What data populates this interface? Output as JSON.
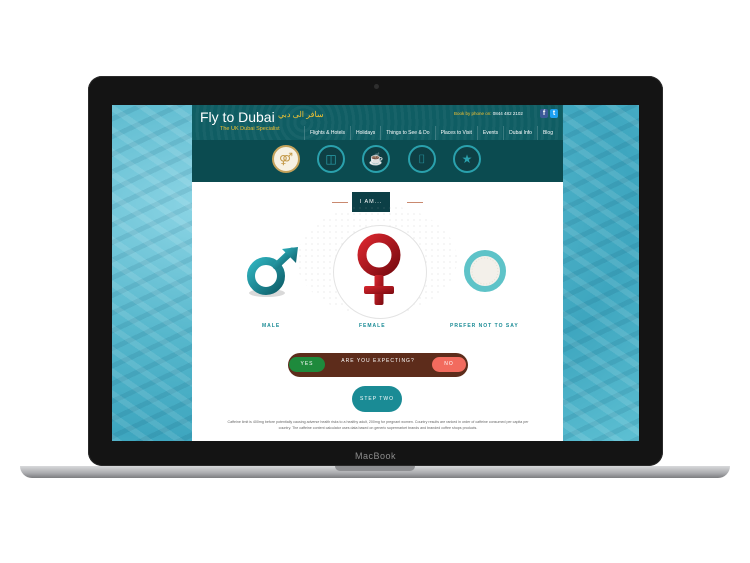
{
  "device": {
    "label": "MacBook"
  },
  "site": {
    "logo_en": "Fly to Dubai",
    "logo_ar": "سافر الى دبي",
    "tagline": "The UK Dubai Specialist",
    "phone_label": "Book by phone on:",
    "phone_number": "0844 482 2102",
    "social": [
      {
        "icon": "facebook-icon",
        "glyph": "f"
      },
      {
        "icon": "twitter-icon",
        "glyph": "t"
      }
    ],
    "nav": [
      "Flights & Hotels",
      "Holidays",
      "Things to See & Do",
      "Places to Visit",
      "Events",
      "Dubai Info",
      "Blog"
    ]
  },
  "steps": [
    {
      "icon": "people-icon",
      "glyph": "⚤",
      "active": true
    },
    {
      "icon": "cup-icon",
      "glyph": "◫",
      "active": false
    },
    {
      "icon": "mug-icon",
      "glyph": "☕",
      "active": false
    },
    {
      "icon": "takeaway-cup-icon",
      "glyph": "⌷",
      "active": false
    },
    {
      "icon": "star-icon",
      "glyph": "★",
      "active": false
    }
  ],
  "question": "I AM...",
  "options": [
    {
      "label": "MALE",
      "icon": "male-symbol-icon",
      "color": "#1a8b95"
    },
    {
      "label": "FEMALE",
      "icon": "female-symbol-icon",
      "color": "#b3161d",
      "selected": true
    },
    {
      "label": "PREFER NOT TO SAY",
      "icon": "ring-icon",
      "color": "#5ec3c8"
    }
  ],
  "expecting": {
    "question": "ARE YOU EXPECTING?",
    "yes": "YES",
    "no": "NO"
  },
  "next_button": "STEP TWO",
  "footnote": "Caffeine limit is 400mg before potentially causing adverse health risks to a healthy adult, 200mg for pregnant women. Country results are ranked in order of caffeine consumed per capita per country. The caffeine content calculator uses data based on generic supermarket brands and branded coffee shops products.",
  "colors": {
    "header": "#0f5d63",
    "accent": "#1a8b95",
    "gold": "#f1c232",
    "female": "#b3161d",
    "yes": "#1e8a3c",
    "no": "#f26b5e",
    "expect_bar": "#5d2c1b"
  }
}
